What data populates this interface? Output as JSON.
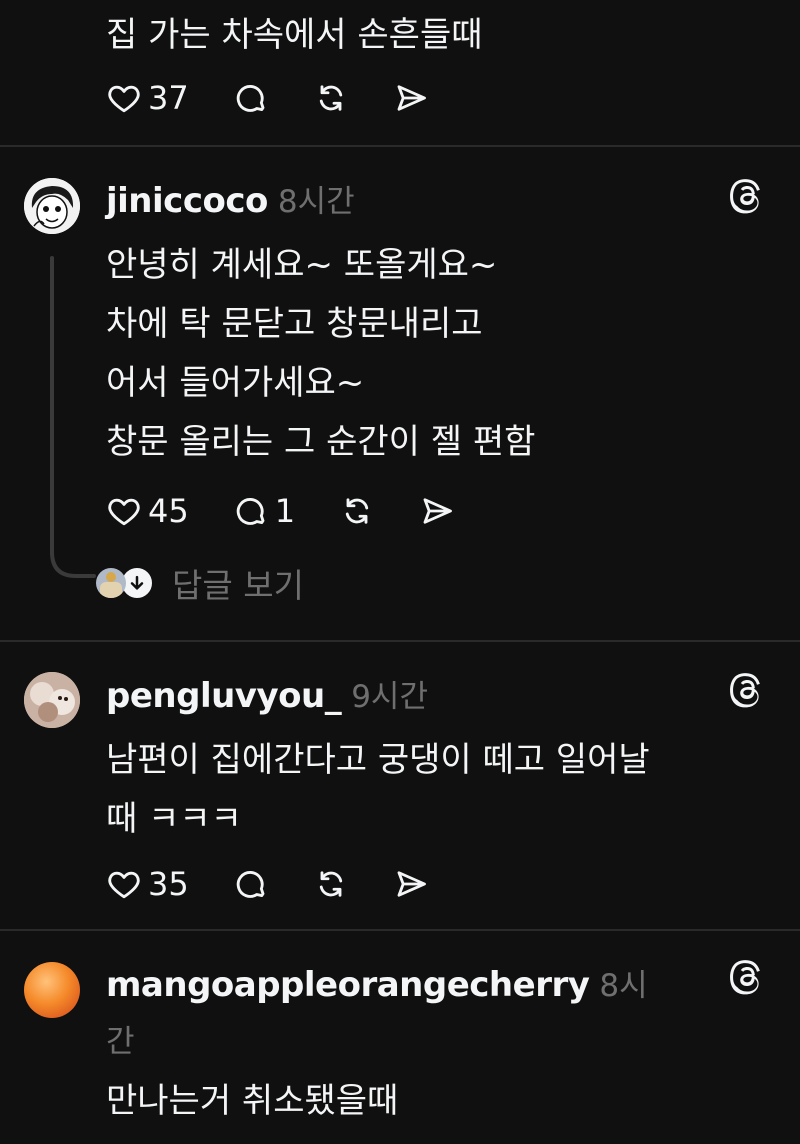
{
  "colors": {
    "background": "#101010",
    "text": "#f3f5f7",
    "muted": "#6f6f6f",
    "divider": "#2a2a2a"
  },
  "top_post": {
    "text": "집 가는 차속에서 손흔들때",
    "likes": "37"
  },
  "post_jiniccoco": {
    "username": "jiniccoco",
    "time": "8시간",
    "text": "안녕히 계세요~ 또올게요~\n차에 탁 문닫고 창문내리고\n어서 들어가세요~\n창문 올리는 그 순간이 젤 편함",
    "likes": "45",
    "comments": "1",
    "view_replies": "답글 보기"
  },
  "post_pengluvyou": {
    "username": "pengluvyou_",
    "time": "9시간",
    "text": "남편이 집에간다고 궁댕이 떼고 일어날\n때 ㅋㅋㅋ",
    "likes": "35"
  },
  "post_mango": {
    "username": "mangoappleorangecherry",
    "time_part1": "8시",
    "time_part2": "간",
    "text": "만나는거 취소됐을때"
  }
}
